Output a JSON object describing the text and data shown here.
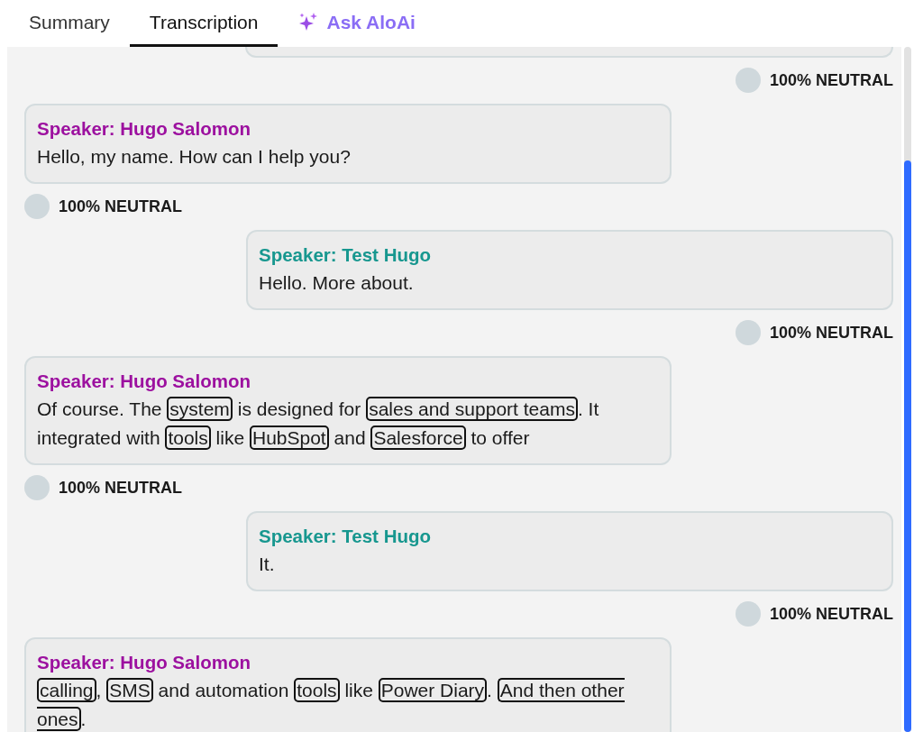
{
  "tabs": [
    {
      "label": "Summary",
      "selected": false,
      "kind": "plain"
    },
    {
      "label": "Transcription",
      "selected": true,
      "kind": "plain"
    },
    {
      "label": "Ask AloAi",
      "selected": false,
      "kind": "ai"
    }
  ],
  "top_sentiment": "100% NEUTRAL",
  "messages": [
    {
      "kind": "left",
      "speaker": "Speaker: Hugo Salomon",
      "color": "#9c109f",
      "segments": [
        {
          "text": "Hello, my name. How can I help you?",
          "highlighted": false
        }
      ],
      "sentiment": "100% NEUTRAL"
    },
    {
      "kind": "right",
      "speaker": "Speaker: Test Hugo",
      "color": "#17978f",
      "segments": [
        {
          "text": "Hello. More about.",
          "highlighted": false
        }
      ],
      "sentiment": "100% NEUTRAL"
    },
    {
      "kind": "left",
      "speaker": "Speaker: Hugo Salomon",
      "color": "#9c109f",
      "segments": [
        {
          "text": "Of course. The ",
          "highlighted": false
        },
        {
          "text": "system",
          "highlighted": true
        },
        {
          "text": " is designed for ",
          "highlighted": false
        },
        {
          "text": "sales and support teams",
          "highlighted": true
        },
        {
          "text": ". It integrated with ",
          "highlighted": false
        },
        {
          "text": "tools",
          "highlighted": true
        },
        {
          "text": " like ",
          "highlighted": false
        },
        {
          "text": "HubSpot",
          "highlighted": true
        },
        {
          "text": " and ",
          "highlighted": false
        },
        {
          "text": "Salesforce",
          "highlighted": true
        },
        {
          "text": " to offer",
          "highlighted": false
        }
      ],
      "sentiment": "100% NEUTRAL"
    },
    {
      "kind": "right",
      "speaker": "Speaker: Test Hugo",
      "color": "#17978f",
      "segments": [
        {
          "text": "It.",
          "highlighted": false
        }
      ],
      "sentiment": "100% NEUTRAL"
    },
    {
      "kind": "left",
      "speaker": "Speaker: Hugo Salomon",
      "color": "#9c109f",
      "segments": [
        {
          "text": "calling",
          "highlighted": true
        },
        {
          "text": ", ",
          "highlighted": false
        },
        {
          "text": "SMS",
          "highlighted": true
        },
        {
          "text": " and automation ",
          "highlighted": false
        },
        {
          "text": "tools",
          "highlighted": true
        },
        {
          "text": " like ",
          "highlighted": false
        },
        {
          "text": "Power Diary",
          "highlighted": true
        },
        {
          "text": ". ",
          "highlighted": false
        },
        {
          "text": "And then other ones",
          "highlighted": true
        },
        {
          "text": ".",
          "highlighted": false
        }
      ]
    }
  ]
}
